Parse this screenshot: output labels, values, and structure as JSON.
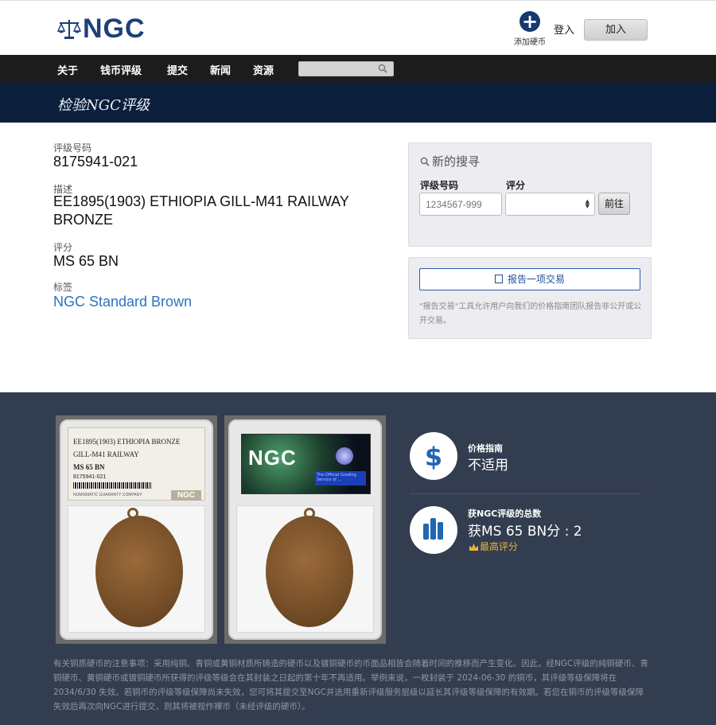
{
  "header": {
    "logo_text": "NGC",
    "add_coin_label": "添加硬币",
    "login_label": "登入",
    "join_label": "加入"
  },
  "nav": {
    "items": [
      "关于",
      "钱币评级",
      "提交",
      "新闻",
      "资源"
    ],
    "search_placeholder": ""
  },
  "banner": {
    "title": "检验NGC评级"
  },
  "details": {
    "cert_label": "评级号码",
    "cert_value": "8175941-021",
    "desc_label": "描述",
    "desc_value_line1": "EE1895(1903) ETHIOPIA GILL-M41 RAILWAY",
    "desc_value_line2": "BRONZE",
    "grade_label": "评分",
    "grade_value": "MS 65 BN",
    "label_label": "标签",
    "label_value": "NGC Standard Brown"
  },
  "search_panel": {
    "title": "新的搜寻",
    "cert_label": "评级号码",
    "grade_label": "评分",
    "cert_placeholder": "1234567-999",
    "grade_selected": "",
    "go_label": "前往"
  },
  "report_panel": {
    "button_label": "报告一项交易",
    "description": "\"报告交易\"工具允许用户向我们的价格指南团队报告非公开或公开交易。"
  },
  "slab_label": {
    "line1": "EE1895(1903) ETHIOPIA BRONZE",
    "line2": "GILL-M41 RAILWAY",
    "line3": "MS 65 BN",
    "line4": "8175941-021",
    "footer": "NUMISMATIC GUARANTY COMPANY",
    "logo": "NGC"
  },
  "slab_back": {
    "holo_text": "NGC",
    "strip_text": "The Official Grading Service of ..."
  },
  "stats": {
    "price_title": "价格指南",
    "price_value": "不适用",
    "census_title": "获NGC评级的总数",
    "census_value": "获MS 65 BN分 : 2",
    "top_grade_label": "最高评分"
  },
  "note": "有关铜质硬币的注意事项：采用纯铜、青铜或黄铜材质所铸造的硬币以及镀铜硬币的币面品相皆会随着时间的推移而产生变化。因此，经NGC评级的纯铜硬币、青铜硬币、黄铜硬币或镀铜硬币所获得的评级等级会在其封装之日起的第十年不再适用。举例来说，一枚封装于 2024-06-30 的铜币，其评级等级保障将在 2034/6/30 失效。若铜币的评级等级保障尚未失效，您可将其提交至NGC并选用重新评级服务层级以延长其评级等级保障的有效期。若您在铜币的评级等级保障失效后再次向NGC进行提交，则其将被视作裸币（未经评级的硬币）。",
  "colors": {
    "nav_bg": "#1c1c1c",
    "banner_bg": "#0b1f3c",
    "lower_bg": "#333d50",
    "link": "#2a74c0",
    "accent_gold": "#e8b53a",
    "brand_blue": "#1d3f7a"
  },
  "icons": {
    "add_coin": "plus-circle-icon",
    "nav_search": "search-icon",
    "panel_search": "search-icon",
    "report": "report-icon",
    "price": "dollar-icon",
    "census": "bar-chart-icon",
    "top_grade": "crown-icon"
  }
}
